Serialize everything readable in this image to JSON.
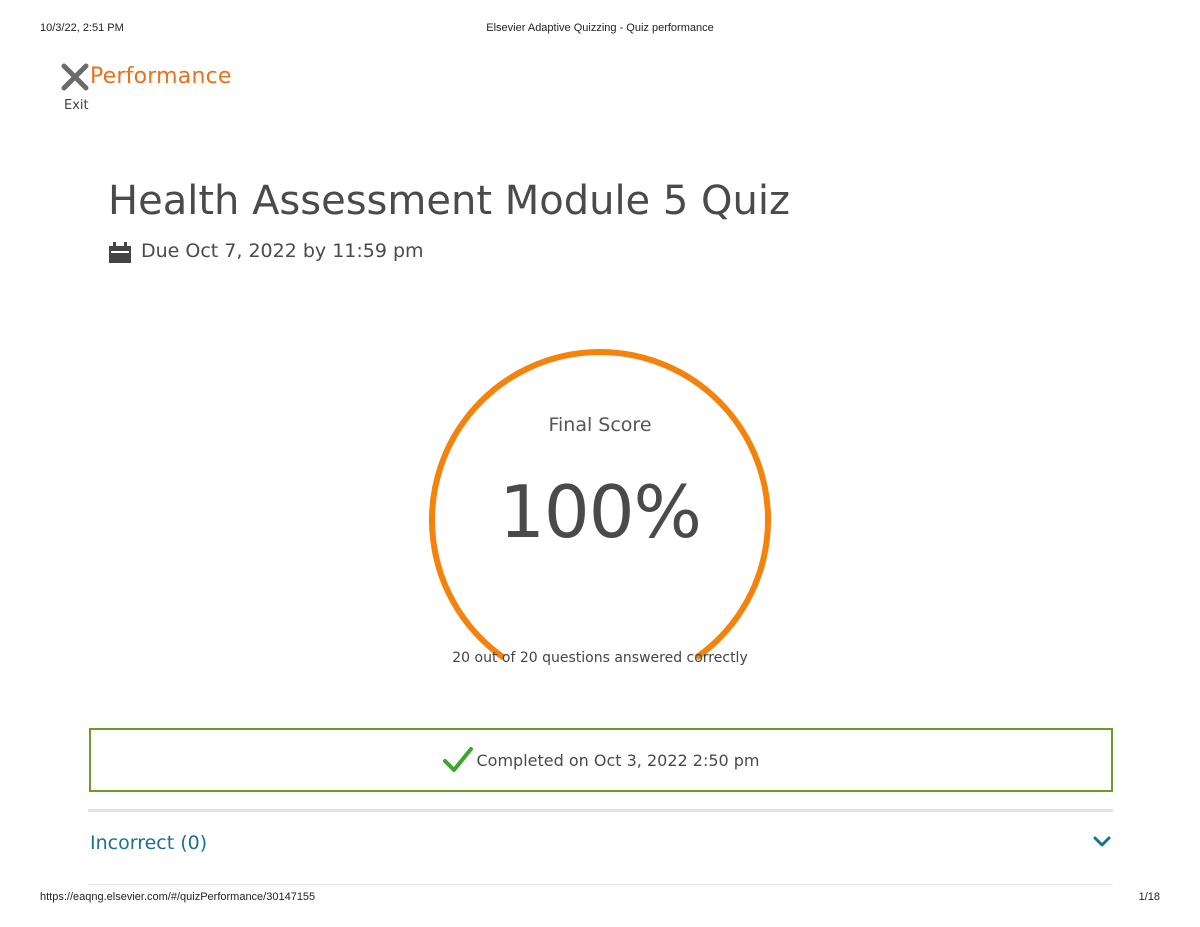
{
  "print_header": {
    "datetime": "10/3/22, 2:51 PM",
    "page_title": "Elsevier Adaptive Quizzing - Quiz performance"
  },
  "print_footer": {
    "url": "https://eaqng.elsevier.com/#/quizPerformance/30147155",
    "page_number": "1/18"
  },
  "header": {
    "exit_label": "Exit",
    "exit_icon": "close-icon",
    "title": "Performance"
  },
  "quiz": {
    "title": "Health Assessment Module 5 Quiz",
    "due_icon": "calendar-icon",
    "due_text": "Due Oct 7, 2022 by 11:59 pm"
  },
  "score": {
    "label": "Final Score",
    "value": "100%",
    "fraction_complete": 1.0,
    "summary": "20 out of 20 questions answered correctly"
  },
  "completion": {
    "icon": "checkmark-icon",
    "text": "Completed on Oct 3, 2022 2:50 pm"
  },
  "sections": {
    "incorrect_label": "Incorrect (0)",
    "incorrect_icon": "chevron-down-icon"
  },
  "colors": {
    "accent_orange": "#f5820a",
    "title_orange": "#e9711c",
    "success_green": "#6f9a27",
    "check_green": "#3aa62a",
    "link_teal": "#1a7090"
  }
}
